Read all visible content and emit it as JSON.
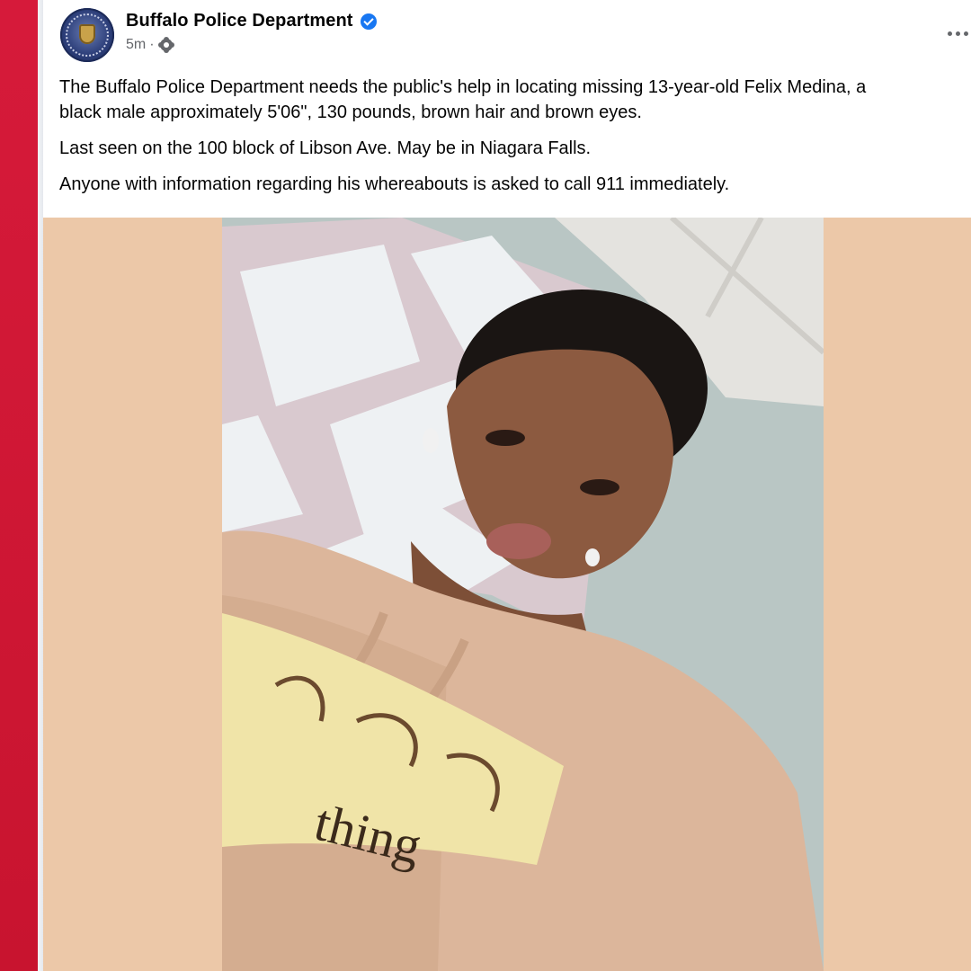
{
  "post": {
    "page_name": "Buffalo Police Department",
    "verified_icon": "verified-badge-icon",
    "timestamp": "5m",
    "separator": "·",
    "privacy_icon": "gear-icon",
    "more_icon": "more-options-icon",
    "paragraphs": [
      "The Buffalo Police Department needs the public's help in locating missing 13-year-old Felix Medina, a",
      "black male approximately 5'06\", 130 pounds, brown hair and brown eyes.",
      "Last seen on the 100 block of Libson Ave. May be in Niagara Falls.",
      "Anyone with information regarding his whereabouts is asked to call 911 immediately."
    ],
    "photo_hoodie_print": "thing"
  },
  "colors": {
    "accent_red": "#d61a3a",
    "verified_blue": "#1877f2",
    "media_background": "#ecc8a8",
    "text_primary": "#050505",
    "text_secondary": "#65676b"
  }
}
